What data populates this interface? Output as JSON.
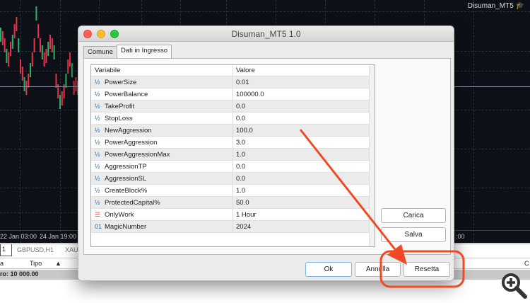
{
  "chart": {
    "symbol": "Disuman_MT5",
    "time_labels": [
      "22 Jan 03:00",
      "24 Jan 19:00",
      ":00"
    ]
  },
  "bottom": {
    "tabs": [
      "1",
      "GBPUSD,H1",
      "XAU"
    ],
    "columns": [
      "a",
      "Tipo",
      "C"
    ],
    "balance": "ro: 10 000.00"
  },
  "dialog": {
    "title": "Disuman_MT5 1.0",
    "tabs": [
      {
        "label": "Comune",
        "active": false
      },
      {
        "label": "Dati in Ingresso",
        "active": true
      }
    ],
    "table": {
      "headers": [
        "Variabile",
        "Valore"
      ],
      "rows": [
        {
          "icon": "fraction-icon",
          "name": "PowerSize",
          "value": "0.01"
        },
        {
          "icon": "fraction-icon",
          "name": "PowerBalance",
          "value": "100000.0"
        },
        {
          "icon": "fraction-icon",
          "name": "TakeProfit",
          "value": "0.0"
        },
        {
          "icon": "fraction-icon",
          "name": "StopLoss",
          "value": "0.0"
        },
        {
          "icon": "fraction-icon",
          "name": "NewAggression",
          "value": "100.0"
        },
        {
          "icon": "fraction-icon",
          "name": "PowerAggression",
          "value": "3.0"
        },
        {
          "icon": "fraction-icon",
          "name": "PowerAggressionMax",
          "value": "1.0"
        },
        {
          "icon": "fraction-icon",
          "name": "AggressionTP",
          "value": "0.0"
        },
        {
          "icon": "fraction-icon",
          "name": "AggressionSL",
          "value": "0.0"
        },
        {
          "icon": "fraction-icon",
          "name": "CreateBlock%",
          "value": "1.0"
        },
        {
          "icon": "fraction-icon",
          "name": "ProtectedCapital%",
          "value": "50.0"
        },
        {
          "icon": "enum-icon",
          "name": "OnlyWork",
          "value": "1 Hour"
        },
        {
          "icon": "integer-icon",
          "name": "MagicNumber",
          "value": "2024"
        }
      ]
    },
    "buttons": {
      "load": "Carica",
      "save": "Salva",
      "ok": "Ok",
      "cancel": "Annulla",
      "reset": "Resetta"
    }
  },
  "colors": {
    "annotation": "#f04a24",
    "bull": "#26b36a",
    "bear": "#e8334a",
    "accent": "#2a6fb8"
  }
}
